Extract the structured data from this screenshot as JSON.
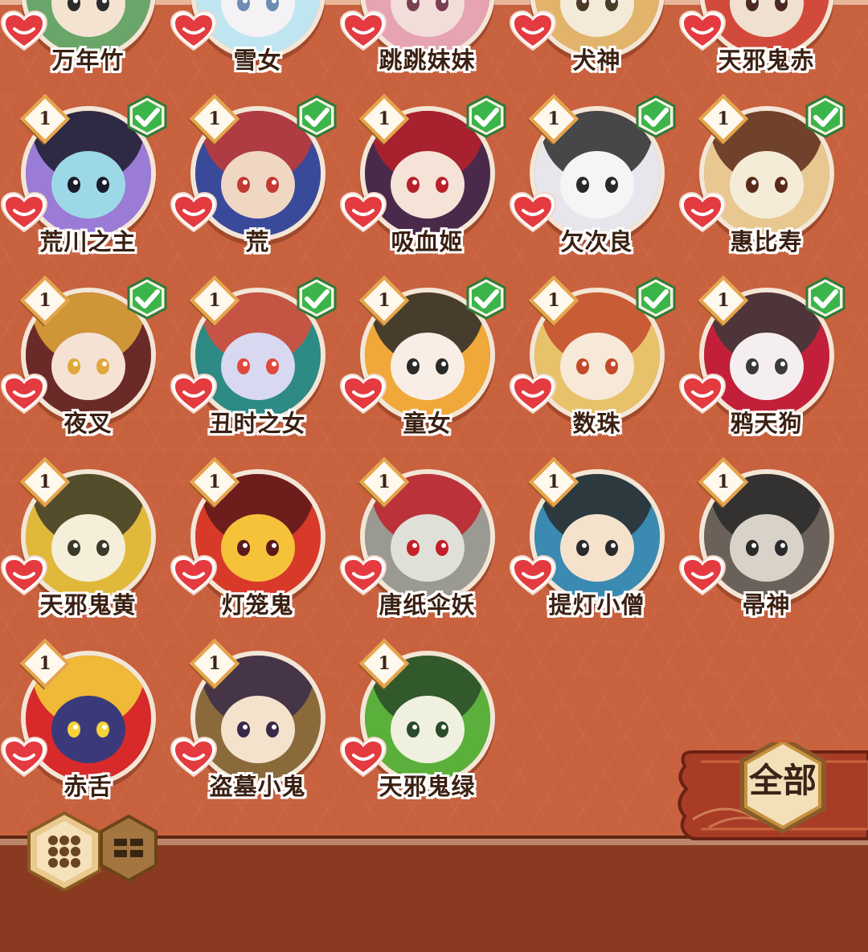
{
  "colors": {
    "panel": "#c8613e",
    "check": "#3bb54a",
    "badge_border": "#e5a44b",
    "heart": "#e43b40",
    "name_text": "#3a2012"
  },
  "cards": [
    {
      "name": "万年竹",
      "count": "",
      "collected": false,
      "palette": [
        "#6aa56a",
        "#f3e3d0",
        "#2b2b2b"
      ]
    },
    {
      "name": "雪女",
      "count": "",
      "collected": false,
      "palette": [
        "#bfe6f0",
        "#f5f2f5",
        "#6f8db3"
      ]
    },
    {
      "name": "跳跳妹妹",
      "count": "",
      "collected": false,
      "palette": [
        "#e6a3b1",
        "#f2ddd8",
        "#7b3f52"
      ]
    },
    {
      "name": "犬神",
      "count": "",
      "collected": false,
      "palette": [
        "#e2b36a",
        "#f3ead8",
        "#4a3a2a"
      ]
    },
    {
      "name": "天邪鬼赤",
      "count": "",
      "collected": false,
      "palette": [
        "#d24a3c",
        "#f0e0d0",
        "#4a2a22"
      ]
    },
    {
      "name": "荒川之主",
      "count": "1",
      "collected": true,
      "palette": [
        "#9a7bd6",
        "#9dd8e6",
        "#1c1c2a"
      ]
    },
    {
      "name": "荒",
      "count": "1",
      "collected": true,
      "palette": [
        "#3a4a9a",
        "#f0d7c4",
        "#c33a32"
      ]
    },
    {
      "name": "吸血姬",
      "count": "1",
      "collected": true,
      "palette": [
        "#4a2a4a",
        "#f5e3d8",
        "#b8202a"
      ]
    },
    {
      "name": "欠次良",
      "count": "1",
      "collected": true,
      "palette": [
        "#e6e6ec",
        "#f5f5f5",
        "#2a2a2a"
      ]
    },
    {
      "name": "惠比寿",
      "count": "1",
      "collected": true,
      "palette": [
        "#e8c890",
        "#f5ecd8",
        "#5a2a1a"
      ]
    },
    {
      "name": "夜叉",
      "count": "1",
      "collected": true,
      "palette": [
        "#6a2a28",
        "#f5e2d5",
        "#e0a83a"
      ]
    },
    {
      "name": "丑时之女",
      "count": "1",
      "collected": true,
      "palette": [
        "#2e8a84",
        "#d8d8f0",
        "#e04a3a"
      ]
    },
    {
      "name": "童女",
      "count": "1",
      "collected": true,
      "palette": [
        "#f0a83a",
        "#f8eee6",
        "#2a2a2a"
      ]
    },
    {
      "name": "数珠",
      "count": "1",
      "collected": true,
      "palette": [
        "#e8c26a",
        "#f7e9d8",
        "#c34a2a"
      ]
    },
    {
      "name": "鸦天狗",
      "count": "1",
      "collected": true,
      "palette": [
        "#c2203a",
        "#f5eef0",
        "#3a3a3a"
      ]
    },
    {
      "name": "天邪鬼黄",
      "count": "1",
      "collected": false,
      "palette": [
        "#e0b83a",
        "#f5eed8",
        "#3a3a2a"
      ]
    },
    {
      "name": "灯笼鬼",
      "count": "1",
      "collected": false,
      "palette": [
        "#d83a2a",
        "#f5c23a",
        "#5a1a1a"
      ]
    },
    {
      "name": "唐纸伞妖",
      "count": "1",
      "collected": false,
      "palette": [
        "#9a9a92",
        "#e0e0d8",
        "#c2202a"
      ]
    },
    {
      "name": "提灯小僧",
      "count": "1",
      "collected": false,
      "palette": [
        "#3a8ab2",
        "#f5e2cc",
        "#2a2a2a"
      ]
    },
    {
      "name": "帚神",
      "count": "1",
      "collected": false,
      "palette": [
        "#6a625a",
        "#d8d2c8",
        "#2a2a2a"
      ]
    },
    {
      "name": "赤舌",
      "count": "1",
      "collected": false,
      "palette": [
        "#d82a2a",
        "#3a3a7a",
        "#f5d23a"
      ]
    },
    {
      "name": "盗墓小鬼",
      "count": "1",
      "collected": false,
      "palette": [
        "#8a6a3a",
        "#f5e2cc",
        "#3a2a4a"
      ]
    },
    {
      "name": "天邪鬼绿",
      "count": "1",
      "collected": false,
      "palette": [
        "#5ab03a",
        "#f0f0e0",
        "#2a4a2a"
      ]
    }
  ],
  "filter": {
    "label": "全部"
  },
  "view_toggle": {
    "grid": "grid-view-icon",
    "list": "list-view-icon"
  }
}
